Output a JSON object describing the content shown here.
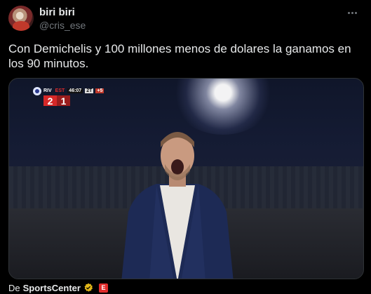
{
  "author": {
    "display_name": "biri biri",
    "handle": "@cris_ese",
    "avatar_icon": "avatar-photo"
  },
  "tweet": {
    "text": "Con Demichelis y 100 millones menos de dolares la ganamos en los 90 minutos."
  },
  "media": {
    "scorebug": {
      "team_home": "RIV",
      "team_away": "EST",
      "score_home": "2",
      "score_away": "1",
      "clock": "46:07",
      "period": "2T",
      "extra": "+5"
    }
  },
  "attribution": {
    "prefix": "De",
    "source": "SportsCenter",
    "verified_color": "#e2b719",
    "badge_color": "#e02b2b",
    "badge_letter": "E"
  },
  "colors": {
    "background": "#000000",
    "text": "#e7e9ea",
    "muted": "#71767b"
  }
}
